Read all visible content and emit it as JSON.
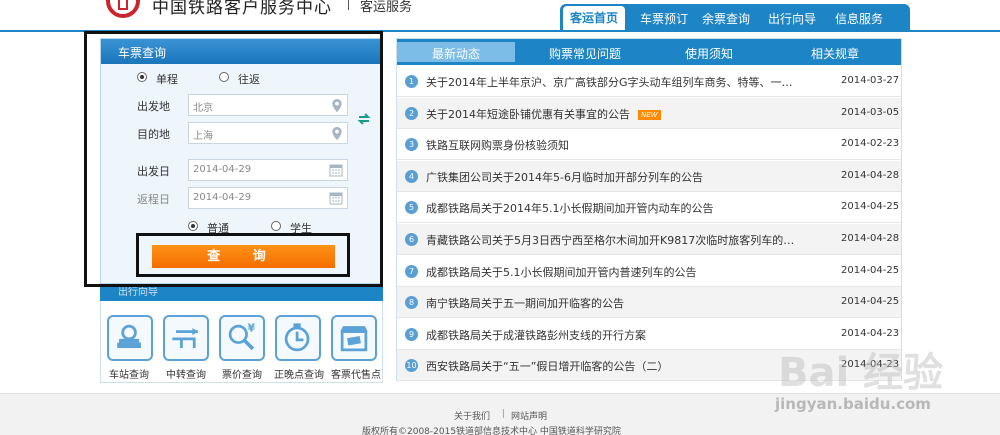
{
  "header": {
    "site_title": "中国铁路客户服务中心",
    "site_sub": "客运服务",
    "nav": [
      "客运首页",
      "车票预订",
      "余票查询",
      "出行向导",
      "信息服务"
    ]
  },
  "ticket": {
    "title": "车票查询",
    "trip_types": [
      "单程",
      "往返"
    ],
    "from_label": "出发地",
    "from_value": "北京",
    "to_label": "目的地",
    "to_value": "上海",
    "depart_label": "出发日",
    "depart_value": "2014-04-29",
    "return_label": "返程日",
    "return_value": "2014-04-29",
    "passenger_types": [
      "普通",
      "学生"
    ],
    "query_label": "查 询"
  },
  "guide": {
    "title": "出行向导",
    "items": [
      "车站查询",
      "中转查询",
      "票价查询",
      "正晚点查询",
      "客票代售点"
    ]
  },
  "news": {
    "tabs": [
      "最新动态",
      "购票常见问题",
      "使用须知",
      "相关规章"
    ],
    "items": [
      {
        "num": "1",
        "title": "关于2014年上半年京沪、京广高铁部分G字头动车组列车商务、特等、一…",
        "date": "2014-03-27"
      },
      {
        "num": "2",
        "title": "关于2014年短途卧铺优惠有关事宜的公告",
        "date": "2014-03-05",
        "badge": "NEW"
      },
      {
        "num": "3",
        "title": "铁路互联网购票身份核验须知",
        "date": "2014-02-23"
      },
      {
        "num": "4",
        "title": "广铁集团公司关于2014年5-6月临时加开部分列车的公告",
        "date": "2014-04-28"
      },
      {
        "num": "5",
        "title": "成都铁路局关于2014年5.1小长假期间加开管内动车的公告",
        "date": "2014-04-25"
      },
      {
        "num": "6",
        "title": "青藏铁路公司关于5月3日西宁西至格尔木间加开K9817次临时旅客列车的…",
        "date": "2014-04-28"
      },
      {
        "num": "7",
        "title": "成都铁路局关于5.1小长假期间加开管内普速列车的公告",
        "date": "2014-04-25"
      },
      {
        "num": "8",
        "title": "南宁铁路局关于五一期间加开临客的公告",
        "date": "2014-04-25"
      },
      {
        "num": "9",
        "title": "成都铁路局关于成灌铁路彭州支线的开行方案",
        "date": "2014-04-23"
      },
      {
        "num": "10",
        "title": "西安铁路局关于“五一”假日增开临客的公告（二）",
        "date": "2014-04-23"
      }
    ]
  },
  "footer": {
    "links": [
      "关于我们",
      "网站声明"
    ],
    "copyright": "版权所有©2008-2015铁道部信息技术中心  中国铁道科学研究院"
  },
  "watermark": {
    "brand": "Bai 经验",
    "url": "jingyan.baidu.com"
  },
  "colors": {
    "primary": "#1d84c6",
    "accent": "#f46d00",
    "logo_red": "#c9272d"
  }
}
